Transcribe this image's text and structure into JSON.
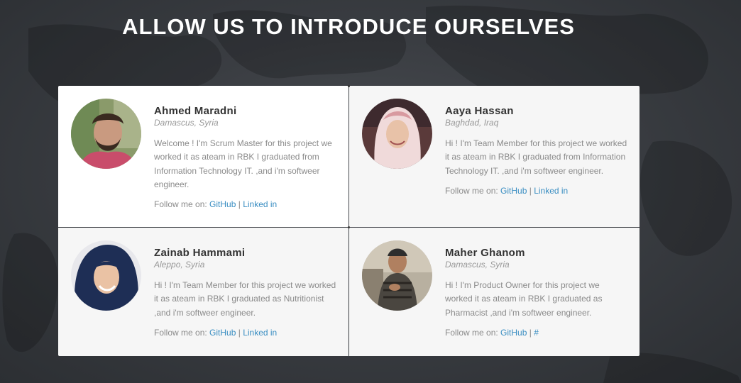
{
  "heading": {
    "light": "ALLOW US TO ",
    "bold": "INTRODUCE OURSELVES"
  },
  "members": [
    {
      "name": "Ahmed Maradni",
      "location": "Damascus, Syria",
      "bio": "Welcome ! I'm Scrum Master for this project we worked it as ateam in RBK I graduated from Information Technology IT. ,and i'm softweer engineer.",
      "follow_label": "Follow me on: ",
      "github": "GitHub",
      "separator": " | ",
      "linkedin": "Linked in"
    },
    {
      "name": "Aaya Hassan",
      "location": "Baghdad, Iraq",
      "bio": "Hi ! I'm Team Member for this project we worked it as ateam in RBK I graduated from Information Technology IT. ,and i'm softweer engineer.",
      "follow_label": "Follow me on: ",
      "github": "GitHub",
      "separator": " | ",
      "linkedin": "Linked in"
    },
    {
      "name": "Zainab Hammami",
      "location": "Aleppo, Syria",
      "bio": "Hi ! I'm Team Member for this project we worked it as ateam in RBK I graduated as Nutritionist ,and i'm softweer engineer.",
      "follow_label": "Follow me on: ",
      "github": "GitHub",
      "separator": " | ",
      "linkedin": "Linked in"
    },
    {
      "name": "Maher Ghanom",
      "location": "Damascus, Syria",
      "bio": "Hi ! I'm Product Owner for this project we worked it as ateam in RBK I graduated as Pharmacist ,and i'm softweer engineer.",
      "follow_label": "Follow me on: ",
      "github": "GitHub",
      "separator": " | ",
      "linkedin": "#"
    }
  ],
  "colors": {
    "link": "#3a8ec2",
    "name": "#333333",
    "text": "#8a8a8a",
    "card_bg": "#f6f6f6"
  }
}
